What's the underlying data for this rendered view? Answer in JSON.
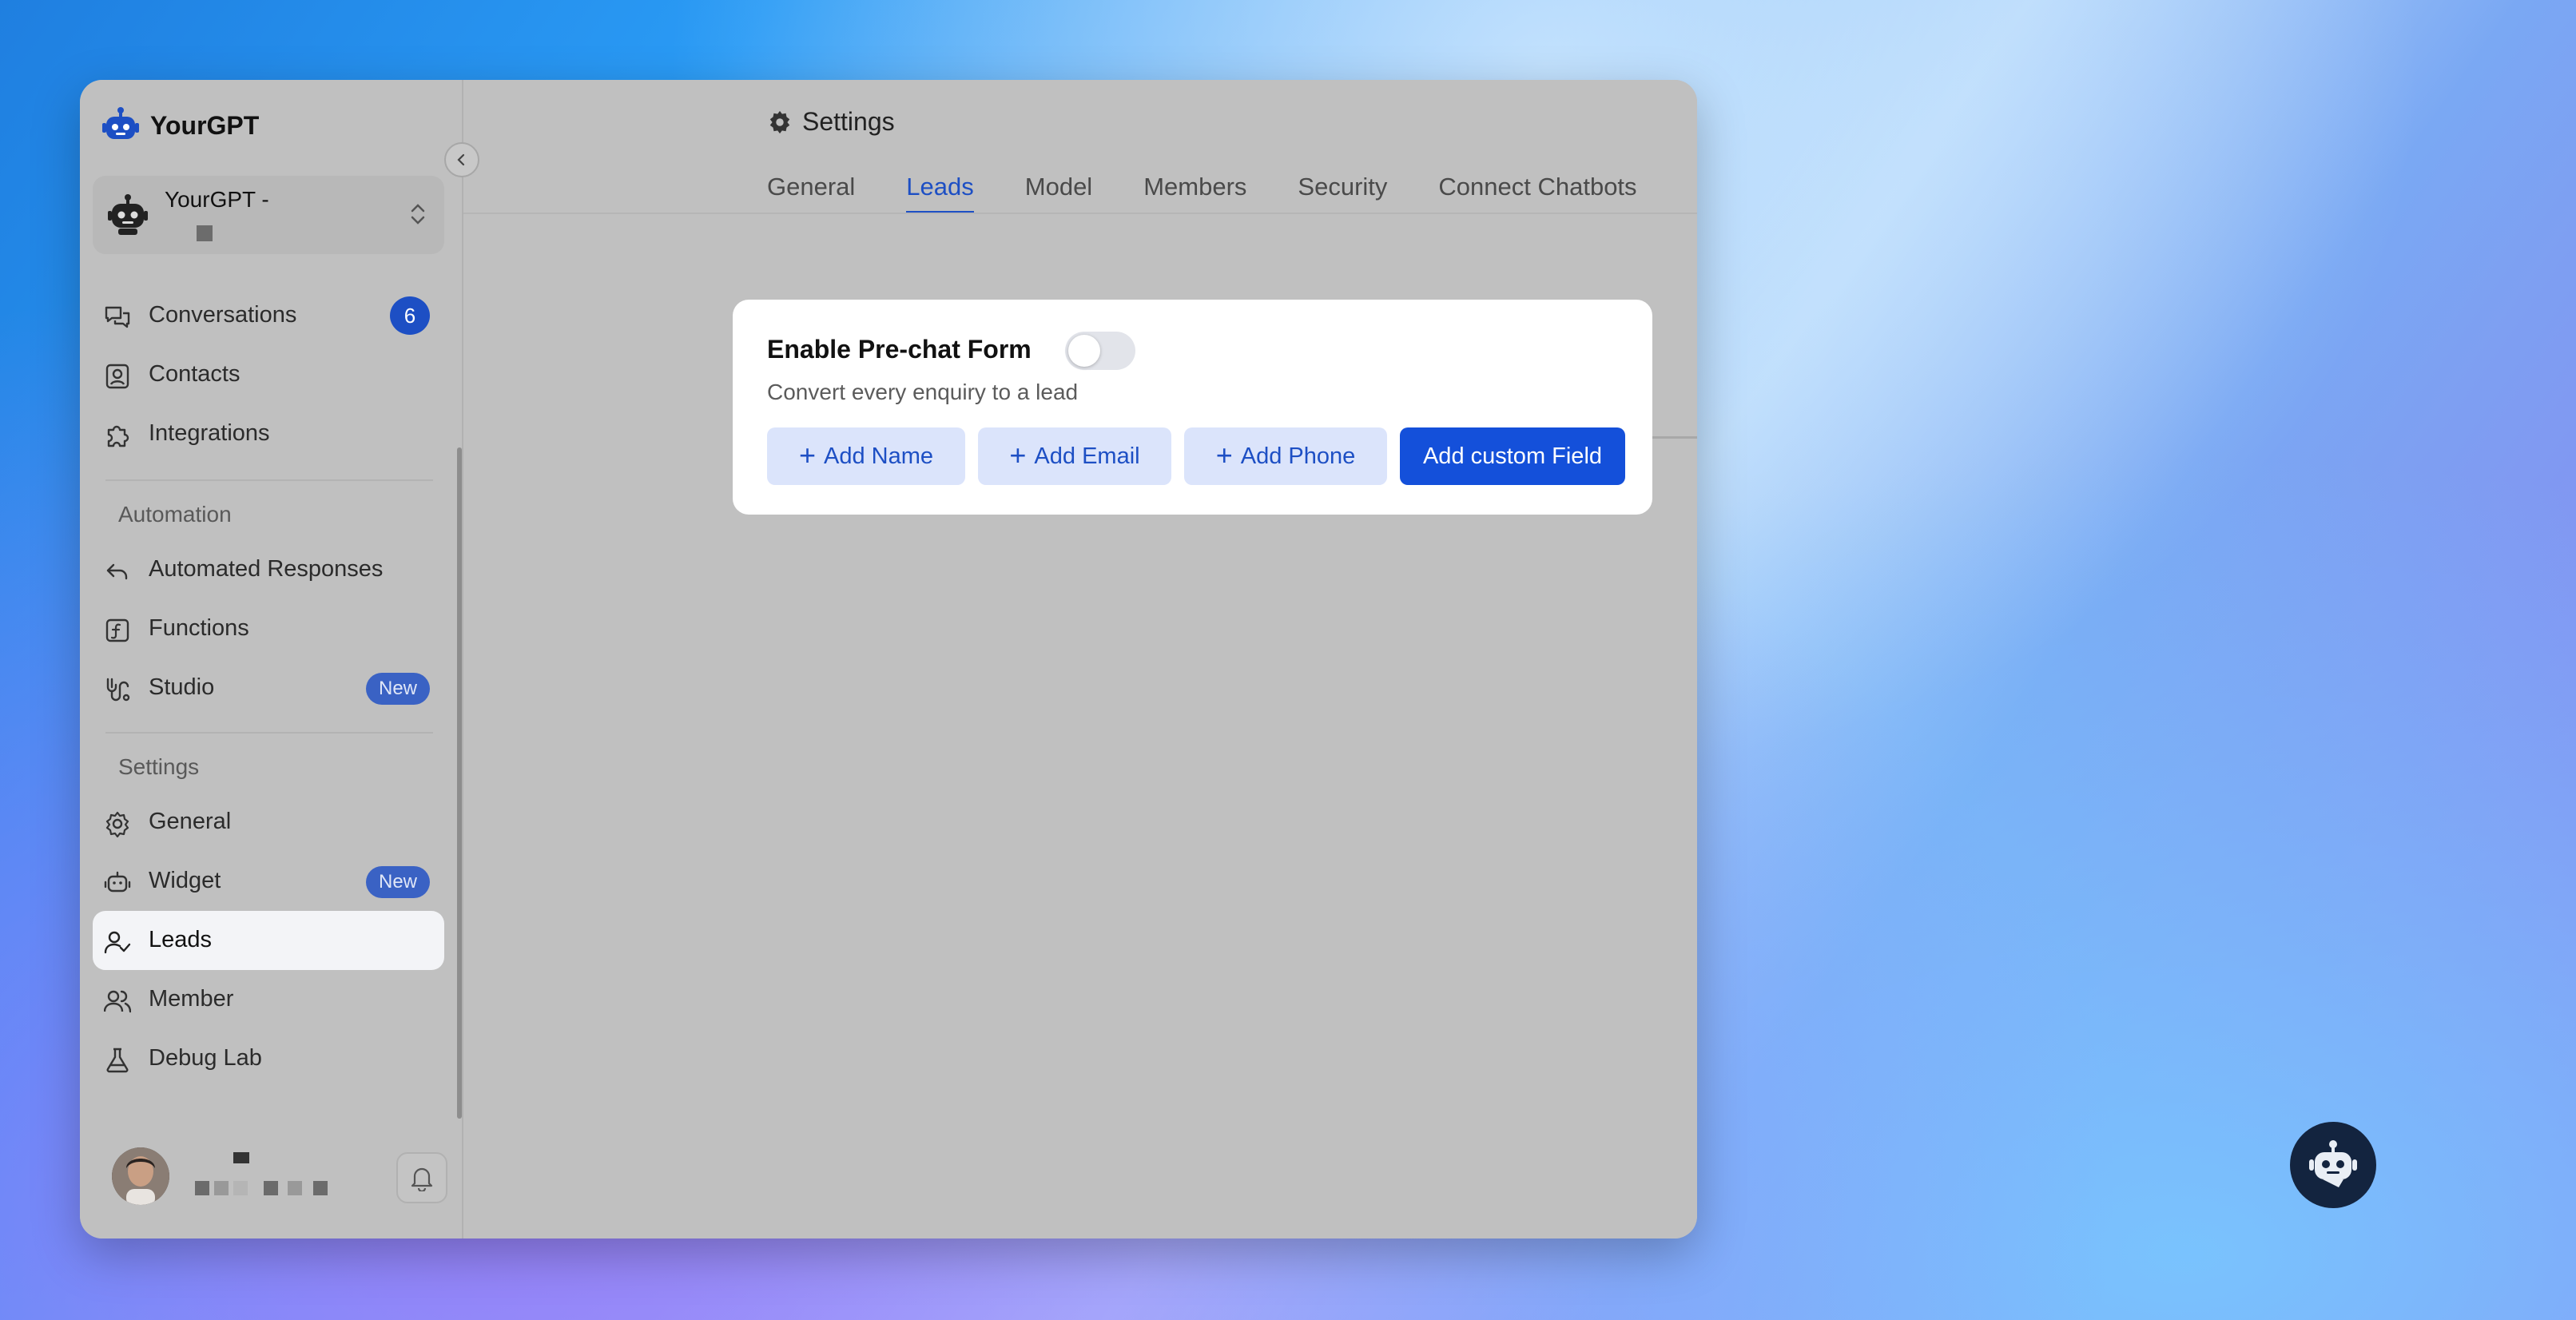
{
  "app": {
    "name": "YourGPT"
  },
  "workspace": {
    "title": "YourGPT -"
  },
  "sidebar": {
    "items": [
      {
        "label": "Conversations",
        "badge": "6"
      },
      {
        "label": "Contacts"
      },
      {
        "label": "Integrations"
      }
    ],
    "automation": {
      "heading": "Automation",
      "items": [
        {
          "label": "Automated Responses"
        },
        {
          "label": "Functions"
        },
        {
          "label": "Studio",
          "badge": "New"
        }
      ]
    },
    "settings": {
      "heading": "Settings",
      "items": [
        {
          "label": "General"
        },
        {
          "label": "Widget",
          "badge": "New"
        },
        {
          "label": "Leads",
          "active": true
        },
        {
          "label": "Member"
        },
        {
          "label": "Debug Lab"
        }
      ]
    }
  },
  "page": {
    "title": "Settings",
    "tabs": [
      "General",
      "Leads",
      "Model",
      "Members",
      "Security",
      "Connect Chatbots"
    ],
    "active_tab": "Leads"
  },
  "prechat": {
    "title": "Enable Pre-chat Form",
    "subtitle": "Convert every enquiry to a lead",
    "enabled": false,
    "buttons": {
      "add_name": "Add Name",
      "add_email": "Add Email",
      "add_phone": "Add Phone",
      "add_custom": "Add custom Field"
    }
  },
  "colors": {
    "accent": "#1d4fc4",
    "primary_button": "#1450da",
    "overlay": "#c0c0c0"
  }
}
